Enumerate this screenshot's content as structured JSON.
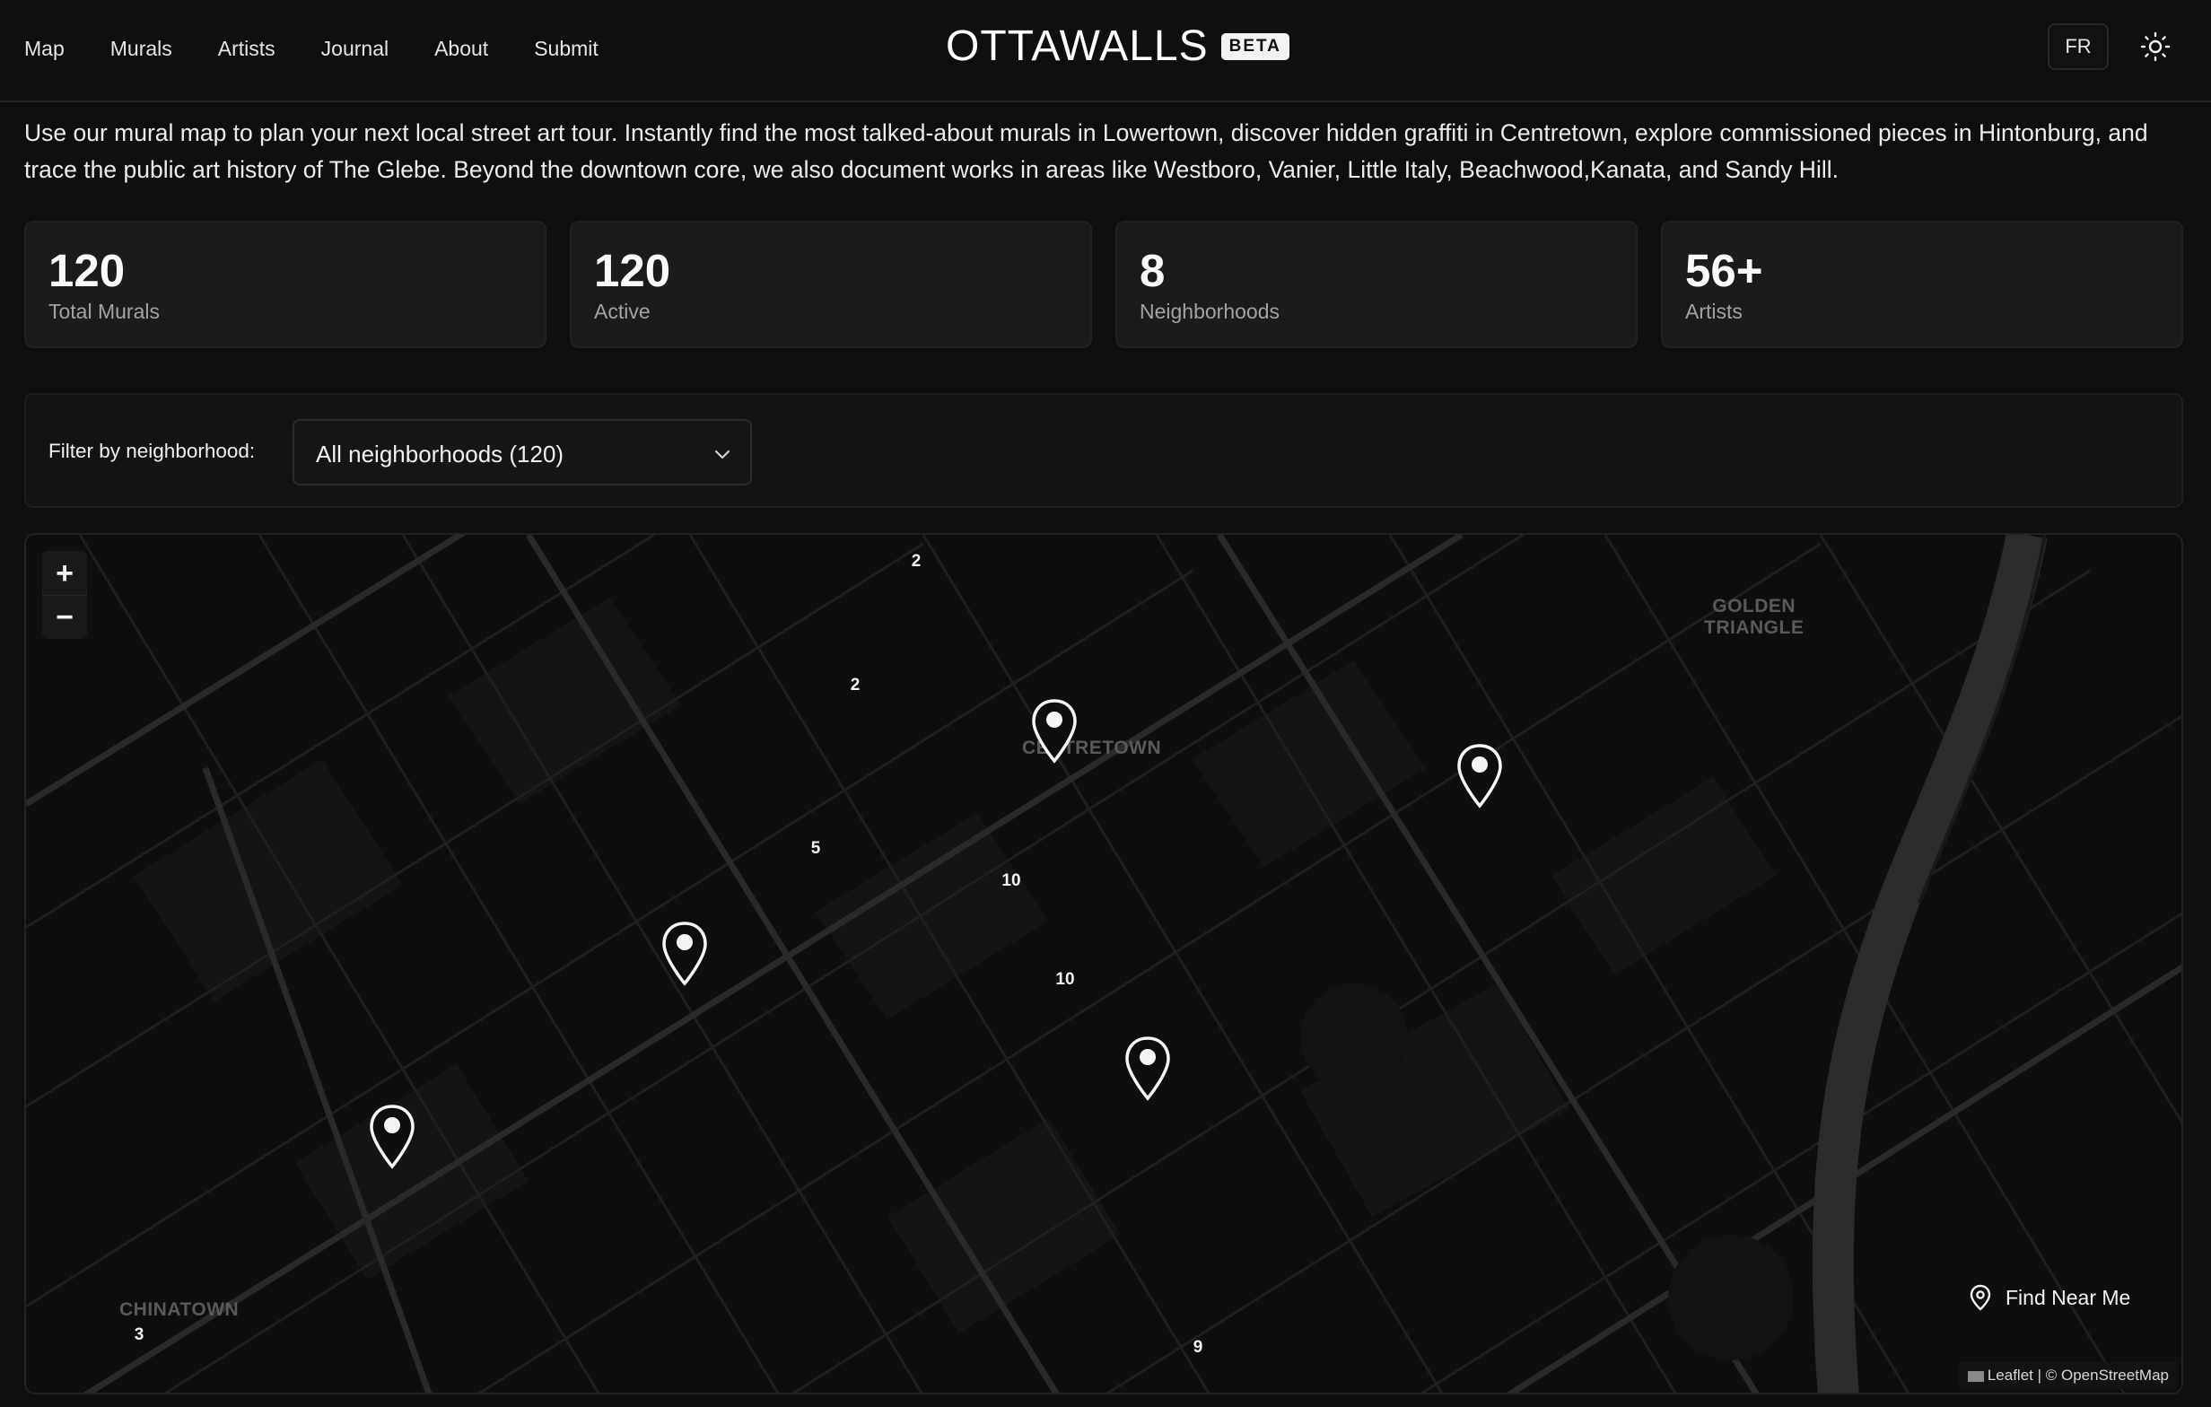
{
  "nav": {
    "items": [
      {
        "label": "Map"
      },
      {
        "label": "Murals"
      },
      {
        "label": "Artists"
      },
      {
        "label": "Journal"
      },
      {
        "label": "About"
      },
      {
        "label": "Submit"
      }
    ]
  },
  "brand": {
    "name": "OTTAWALLS",
    "badge": "BETA"
  },
  "header": {
    "language_button": "FR",
    "theme_icon": "sun-icon"
  },
  "intro": "Use our mural map to plan your next local street art tour. Instantly find the most talked-about murals in Lowertown, discover hidden graffiti in Centretown, explore commissioned pieces in Hintonburg, and trace the public art history of The Glebe. Beyond the downtown core, we also document works in areas like Westboro, Vanier, Little Italy, Beachwood,Kanata, and Sandy Hill.",
  "stats": [
    {
      "value": "120",
      "label": "Total Murals"
    },
    {
      "value": "120",
      "label": "Active"
    },
    {
      "value": "8",
      "label": "Neighborhoods"
    },
    {
      "value": "56+",
      "label": "Artists"
    }
  ],
  "filter": {
    "label": "Filter by neighborhood:",
    "selected": "All neighborhoods (120)"
  },
  "map": {
    "zoom_in": "+",
    "zoom_out": "−",
    "area_labels": {
      "centretown": "CENTRETOWN",
      "golden_line1": "GOLDEN",
      "golden_line2": "TRIANGLE",
      "chinatown": "CHINATOWN"
    },
    "clusters": [
      "2",
      "2",
      "5",
      "10",
      "10",
      "3",
      "9"
    ],
    "find_near_me": "Find Near Me",
    "attribution": "Leaflet | © OpenStreetMap"
  },
  "colors": {
    "background": "#0f0f0f",
    "card": "#1b1b1b",
    "text": "#ffffff",
    "muted": "#a3a3a3"
  }
}
